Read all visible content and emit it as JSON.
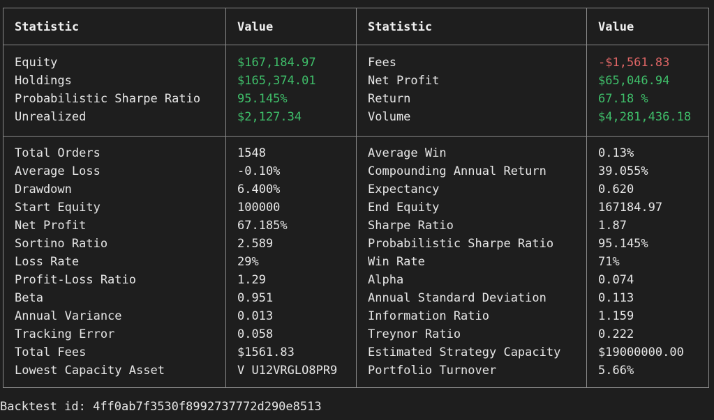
{
  "headers": [
    "Statistic",
    "Value",
    "Statistic",
    "Value"
  ],
  "summary_rows": [
    {
      "s1": "Equity",
      "v1": "$167,184.97",
      "c1": "green",
      "s2": "Fees",
      "v2": "-$1,561.83",
      "c2": "red"
    },
    {
      "s1": "Holdings",
      "v1": "$165,374.01",
      "c1": "green",
      "s2": "Net Profit",
      "v2": "$65,046.94",
      "c2": "green"
    },
    {
      "s1": "Probabilistic Sharpe Ratio",
      "v1": "95.145%",
      "c1": "green",
      "s2": "Return",
      "v2": "67.18 %",
      "c2": "green"
    },
    {
      "s1": "Unrealized",
      "v1": "$2,127.34",
      "c1": "green",
      "s2": "Volume",
      "v2": "$4,281,436.18",
      "c2": "green"
    }
  ],
  "stats_rows": [
    {
      "s1": "Total Orders",
      "v1": "1548",
      "s2": "Average Win",
      "v2": "0.13%"
    },
    {
      "s1": "Average Loss",
      "v1": "-0.10%",
      "s2": "Compounding Annual Return",
      "v2": "39.055%"
    },
    {
      "s1": "Drawdown",
      "v1": "6.400%",
      "s2": "Expectancy",
      "v2": "0.620"
    },
    {
      "s1": "Start Equity",
      "v1": "100000",
      "s2": "End Equity",
      "v2": "167184.97"
    },
    {
      "s1": "Net Profit",
      "v1": "67.185%",
      "s2": "Sharpe Ratio",
      "v2": "1.87"
    },
    {
      "s1": "Sortino Ratio",
      "v1": "2.589",
      "s2": "Probabilistic Sharpe Ratio",
      "v2": "95.145%"
    },
    {
      "s1": "Loss Rate",
      "v1": "29%",
      "s2": "Win Rate",
      "v2": "71%"
    },
    {
      "s1": "Profit-Loss Ratio",
      "v1": "1.29",
      "s2": "Alpha",
      "v2": "0.074"
    },
    {
      "s1": "Beta",
      "v1": "0.951",
      "s2": "Annual Standard Deviation",
      "v2": "0.113"
    },
    {
      "s1": "Annual Variance",
      "v1": "0.013",
      "s2": "Information Ratio",
      "v2": "1.159"
    },
    {
      "s1": "Tracking Error",
      "v1": "0.058",
      "s2": "Treynor Ratio",
      "v2": "0.222"
    },
    {
      "s1": "Total Fees",
      "v1": "$1561.83",
      "s2": "Estimated Strategy Capacity",
      "v2": "$19000000.00"
    },
    {
      "s1": "Lowest Capacity Asset",
      "v1": "V U12VRGLO8PR9",
      "s2": "Portfolio Turnover",
      "v2": "5.66%"
    }
  ],
  "footer": {
    "backtest_id_label": "Backtest id:",
    "backtest_id": "4ff0ab7f3530f8992737772d290e8513"
  },
  "colors": {
    "background": "#1e1e1e",
    "text": "#e6e6e6",
    "positive": "#3fbf6a",
    "negative": "#e06666",
    "border": "#8a8a8a"
  }
}
